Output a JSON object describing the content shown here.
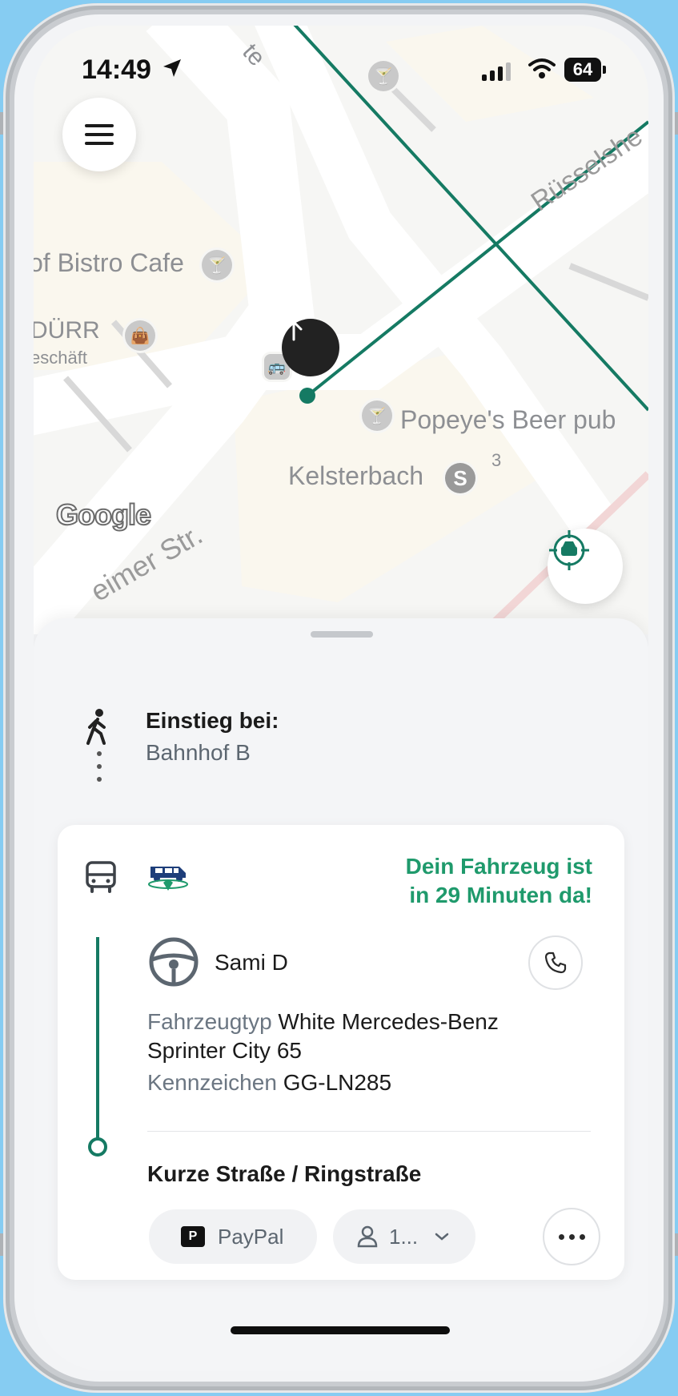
{
  "status_bar": {
    "time": "14:49",
    "battery": "64"
  },
  "map": {
    "labels": {
      "bistro": "of Bistro Cafe",
      "durr": "DÜRR",
      "geschaeft": "eschäft",
      "popeye": "Popeye's Beer pub",
      "kelsterbach": "Kelsterbach",
      "platform": "3",
      "street_ruesselsheim": "Rüsselshe",
      "street_bottom": "eimer Str.",
      "street_top": "te",
      "google": "Google"
    },
    "s_bahn_badge": "S",
    "route_color": "#157a63"
  },
  "sheet": {
    "boarding_label": "Einstieg bei:",
    "boarding_value": "Bahnhof B",
    "eta_line1": "Dein Fahrzeug ist",
    "eta_line2": "in 29 Minuten da!",
    "driver_name": "Sami D",
    "vehicle_type_label": "Fahrzeugtyp",
    "vehicle_type_value": "White Mercedes-Benz Sprinter City 65",
    "plate_label": "Kennzeichen",
    "plate_value": "GG-LN285",
    "destination": "Kurze Straße / Ringstraße",
    "payment_label": "PayPal",
    "payment_icon_text": "P",
    "passengers_label": "1...",
    "accent_color": "#1f9a6c"
  }
}
